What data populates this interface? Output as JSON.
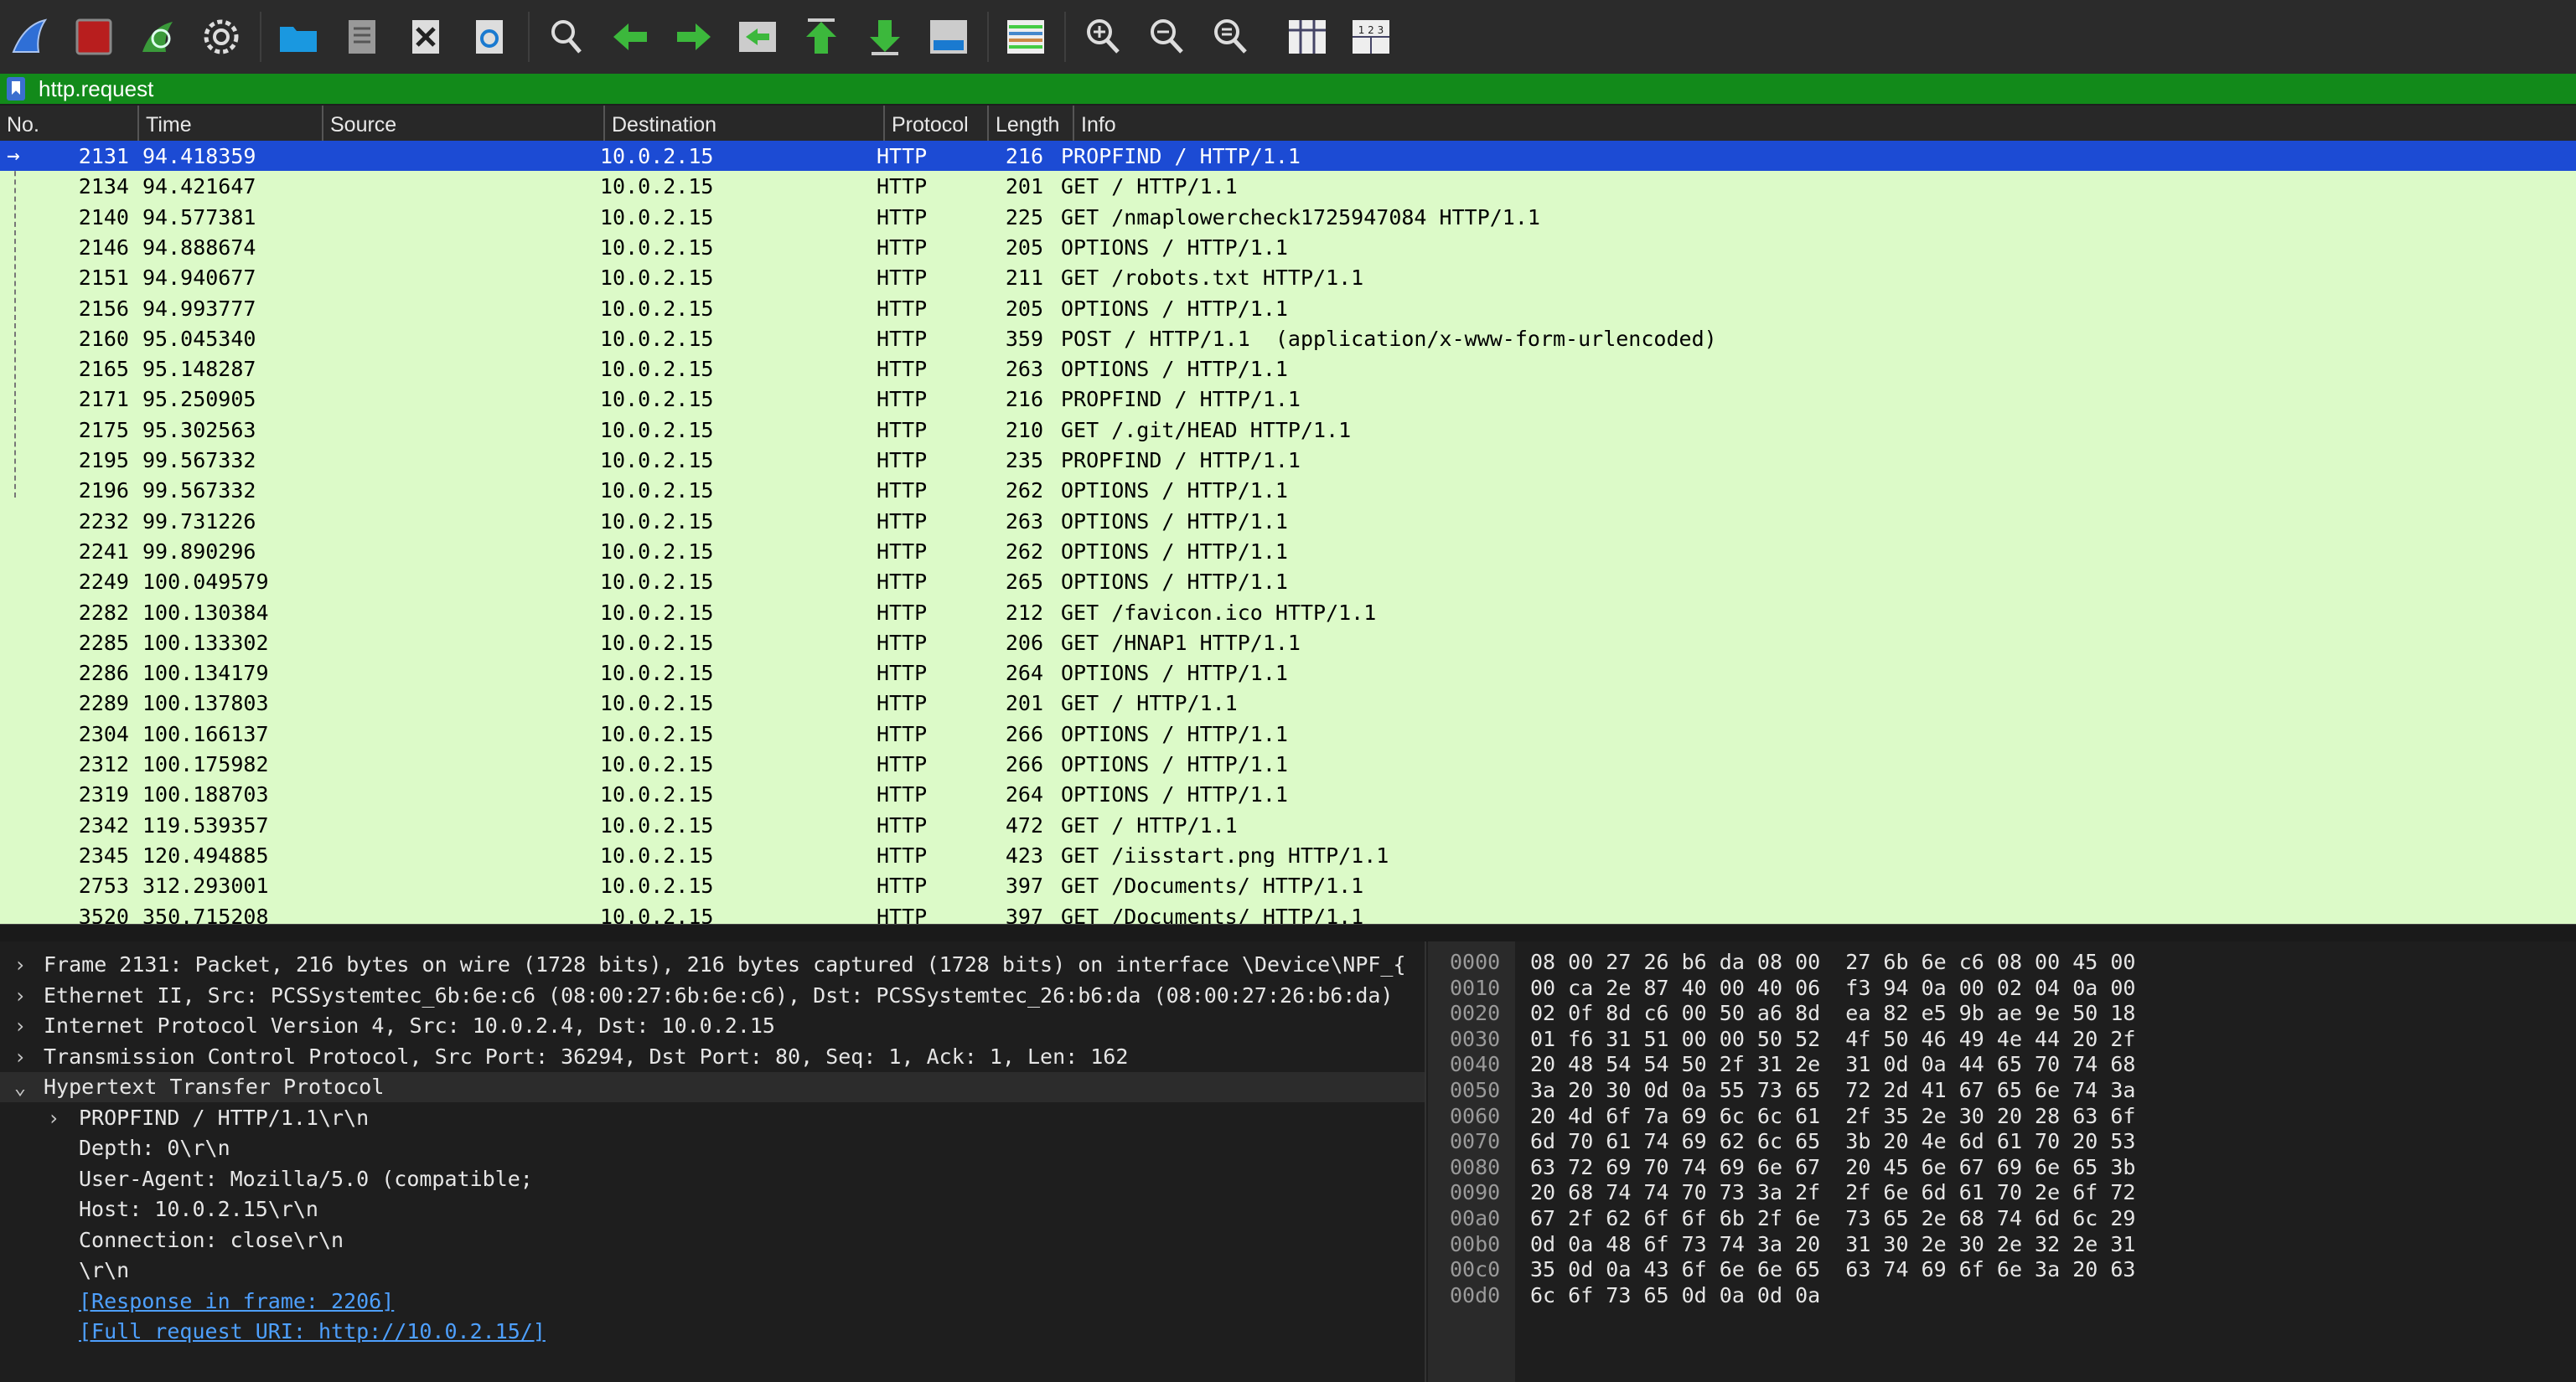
{
  "toolbar": {
    "icons": [
      "shark-fin-icon",
      "stop-icon",
      "restart-icon",
      "gear-icon",
      "folder-icon",
      "file-icon",
      "close-file-icon",
      "reload-icon",
      "search-icon",
      "back-arrow-icon",
      "forward-arrow-icon",
      "go-to-packet-icon",
      "first-packet-icon",
      "last-packet-icon",
      "autoscroll-icon",
      "colorize-icon",
      "zoom-in-icon",
      "zoom-out-icon",
      "zoom-reset-icon",
      "resize-columns-icon",
      "column-numbers-icon"
    ],
    "column_icon_text": "1 2 3"
  },
  "filter": {
    "value": "http.request"
  },
  "columns": [
    "No.",
    "Time",
    "Source",
    "Destination",
    "Protocol",
    "Length",
    "Info"
  ],
  "packets": [
    {
      "no": "2131",
      "time": "94.418359",
      "src": "",
      "dst": "10.0.2.15",
      "proto": "HTTP",
      "len": "216",
      "info": "PROPFIND / HTTP/1.1",
      "selected": true
    },
    {
      "no": "2134",
      "time": "94.421647",
      "src": "",
      "dst": "10.0.2.15",
      "proto": "HTTP",
      "len": "201",
      "info": "GET / HTTP/1.1"
    },
    {
      "no": "2140",
      "time": "94.577381",
      "src": "",
      "dst": "10.0.2.15",
      "proto": "HTTP",
      "len": "225",
      "info": "GET /nmaplowercheck1725947084 HTTP/1.1"
    },
    {
      "no": "2146",
      "time": "94.888674",
      "src": "",
      "dst": "10.0.2.15",
      "proto": "HTTP",
      "len": "205",
      "info": "OPTIONS / HTTP/1.1"
    },
    {
      "no": "2151",
      "time": "94.940677",
      "src": "",
      "dst": "10.0.2.15",
      "proto": "HTTP",
      "len": "211",
      "info": "GET /robots.txt HTTP/1.1"
    },
    {
      "no": "2156",
      "time": "94.993777",
      "src": "",
      "dst": "10.0.2.15",
      "proto": "HTTP",
      "len": "205",
      "info": "OPTIONS / HTTP/1.1"
    },
    {
      "no": "2160",
      "time": "95.045340",
      "src": "",
      "dst": "10.0.2.15",
      "proto": "HTTP",
      "len": "359",
      "info": "POST / HTTP/1.1  (application/x-www-form-urlencoded)"
    },
    {
      "no": "2165",
      "time": "95.148287",
      "src": "",
      "dst": "10.0.2.15",
      "proto": "HTTP",
      "len": "263",
      "info": "OPTIONS / HTTP/1.1"
    },
    {
      "no": "2171",
      "time": "95.250905",
      "src": "",
      "dst": "10.0.2.15",
      "proto": "HTTP",
      "len": "216",
      "info": "PROPFIND / HTTP/1.1"
    },
    {
      "no": "2175",
      "time": "95.302563",
      "src": "",
      "dst": "10.0.2.15",
      "proto": "HTTP",
      "len": "210",
      "info": "GET /.git/HEAD HTTP/1.1"
    },
    {
      "no": "2195",
      "time": "99.567332",
      "src": "",
      "dst": "10.0.2.15",
      "proto": "HTTP",
      "len": "235",
      "info": "PROPFIND / HTTP/1.1"
    },
    {
      "no": "2196",
      "time": "99.567332",
      "src": "",
      "dst": "10.0.2.15",
      "proto": "HTTP",
      "len": "262",
      "info": "OPTIONS / HTTP/1.1"
    },
    {
      "no": "2232",
      "time": "99.731226",
      "src": "",
      "dst": "10.0.2.15",
      "proto": "HTTP",
      "len": "263",
      "info": "OPTIONS / HTTP/1.1"
    },
    {
      "no": "2241",
      "time": "99.890296",
      "src": "",
      "dst": "10.0.2.15",
      "proto": "HTTP",
      "len": "262",
      "info": "OPTIONS / HTTP/1.1"
    },
    {
      "no": "2249",
      "time": "100.049579",
      "src": "",
      "dst": "10.0.2.15",
      "proto": "HTTP",
      "len": "265",
      "info": "OPTIONS / HTTP/1.1"
    },
    {
      "no": "2282",
      "time": "100.130384",
      "src": "",
      "dst": "10.0.2.15",
      "proto": "HTTP",
      "len": "212",
      "info": "GET /favicon.ico HTTP/1.1"
    },
    {
      "no": "2285",
      "time": "100.133302",
      "src": "",
      "dst": "10.0.2.15",
      "proto": "HTTP",
      "len": "206",
      "info": "GET /HNAP1 HTTP/1.1"
    },
    {
      "no": "2286",
      "time": "100.134179",
      "src": "",
      "dst": "10.0.2.15",
      "proto": "HTTP",
      "len": "264",
      "info": "OPTIONS / HTTP/1.1"
    },
    {
      "no": "2289",
      "time": "100.137803",
      "src": "",
      "dst": "10.0.2.15",
      "proto": "HTTP",
      "len": "201",
      "info": "GET / HTTP/1.1"
    },
    {
      "no": "2304",
      "time": "100.166137",
      "src": "",
      "dst": "10.0.2.15",
      "proto": "HTTP",
      "len": "266",
      "info": "OPTIONS / HTTP/1.1"
    },
    {
      "no": "2312",
      "time": "100.175982",
      "src": "",
      "dst": "10.0.2.15",
      "proto": "HTTP",
      "len": "266",
      "info": "OPTIONS / HTTP/1.1"
    },
    {
      "no": "2319",
      "time": "100.188703",
      "src": "",
      "dst": "10.0.2.15",
      "proto": "HTTP",
      "len": "264",
      "info": "OPTIONS / HTTP/1.1"
    },
    {
      "no": "2342",
      "time": "119.539357",
      "src": "",
      "dst": "10.0.2.15",
      "proto": "HTTP",
      "len": "472",
      "info": "GET / HTTP/1.1"
    },
    {
      "no": "2345",
      "time": "120.494885",
      "src": "",
      "dst": "10.0.2.15",
      "proto": "HTTP",
      "len": "423",
      "info": "GET /iisstart.png HTTP/1.1"
    },
    {
      "no": "2753",
      "time": "312.293001",
      "src": "",
      "dst": "10.0.2.15",
      "proto": "HTTP",
      "len": "397",
      "info": "GET /Documents/ HTTP/1.1"
    },
    {
      "no": "3520",
      "time": "350.715208",
      "src": "",
      "dst": "10.0.2.15",
      "proto": "HTTP",
      "len": "397",
      "info": "GET /Documents/ HTTP/1.1"
    }
  ],
  "details": [
    {
      "indent": 0,
      "chevron": "right",
      "text": "Frame 2131: Packet, 216 bytes on wire (1728 bits), 216 bytes captured (1728 bits) on interface \\Device\\NPF_{"
    },
    {
      "indent": 0,
      "chevron": "right",
      "text": "Ethernet II, Src: PCSSystemtec_6b:6e:c6 (08:00:27:6b:6e:c6), Dst: PCSSystemtec_26:b6:da (08:00:27:26:b6:da)"
    },
    {
      "indent": 0,
      "chevron": "right",
      "text": "Internet Protocol Version 4, Src: 10.0.2.4, Dst: 10.0.2.15"
    },
    {
      "indent": 0,
      "chevron": "right",
      "text": "Transmission Control Protocol, Src Port: 36294, Dst Port: 80, Seq: 1, Ack: 1, Len: 162"
    },
    {
      "indent": 0,
      "chevron": "down",
      "text": "Hypertext Transfer Protocol",
      "hl": true
    },
    {
      "indent": 1,
      "chevron": "right",
      "text": "PROPFIND / HTTP/1.1\\r\\n"
    },
    {
      "indent": 1,
      "chevron": "",
      "text": "Depth: 0\\r\\n"
    },
    {
      "indent": 1,
      "chevron": "",
      "text": "User-Agent: Mozilla/5.0 (compatible;"
    },
    {
      "indent": 1,
      "chevron": "",
      "text": "Host: 10.0.2.15\\r\\n"
    },
    {
      "indent": 1,
      "chevron": "",
      "text": "Connection: close\\r\\n"
    },
    {
      "indent": 1,
      "chevron": "",
      "text": "\\r\\n"
    },
    {
      "indent": 1,
      "chevron": "",
      "text": "[Response in frame: 2206]",
      "link": true
    },
    {
      "indent": 1,
      "chevron": "",
      "text": "[Full request URI: http://10.0.2.15/]",
      "link": true
    }
  ],
  "bytes": [
    {
      "offset": "0000",
      "hex": "08 00 27 26 b6 da 08 00  27 6b 6e c6 08 00 45 00"
    },
    {
      "offset": "0010",
      "hex": "00 ca 2e 87 40 00 40 06  f3 94 0a 00 02 04 0a 00"
    },
    {
      "offset": "0020",
      "hex": "02 0f 8d c6 00 50 a6 8d  ea 82 e5 9b ae 9e 50 18"
    },
    {
      "offset": "0030",
      "hex": "01 f6 31 51 00 00 50 52  4f 50 46 49 4e 44 20 2f"
    },
    {
      "offset": "0040",
      "hex": "20 48 54 54 50 2f 31 2e  31 0d 0a 44 65 70 74 68"
    },
    {
      "offset": "0050",
      "hex": "3a 20 30 0d 0a 55 73 65  72 2d 41 67 65 6e 74 3a"
    },
    {
      "offset": "0060",
      "hex": "20 4d 6f 7a 69 6c 6c 61  2f 35 2e 30 20 28 63 6f"
    },
    {
      "offset": "0070",
      "hex": "6d 70 61 74 69 62 6c 65  3b 20 4e 6d 61 70 20 53"
    },
    {
      "offset": "0080",
      "hex": "63 72 69 70 74 69 6e 67  20 45 6e 67 69 6e 65 3b"
    },
    {
      "offset": "0090",
      "hex": "20 68 74 74 70 73 3a 2f  2f 6e 6d 61 70 2e 6f 72"
    },
    {
      "offset": "00a0",
      "hex": "67 2f 62 6f 6f 6b 2f 6e  73 65 2e 68 74 6d 6c 29"
    },
    {
      "offset": "00b0",
      "hex": "0d 0a 48 6f 73 74 3a 20  31 30 2e 30 2e 32 2e 31"
    },
    {
      "offset": "00c0",
      "hex": "35 0d 0a 43 6f 6e 6e 65  63 74 69 6f 6e 3a 20 63"
    },
    {
      "offset": "00d0",
      "hex": "6c 6f 73 65 0d 0a 0d 0a"
    }
  ],
  "colors": {
    "row_bg": "#dcfac8",
    "selected_bg": "#1c4bd4",
    "filter_bg": "#128a1a",
    "link": "#4ea0ff"
  }
}
